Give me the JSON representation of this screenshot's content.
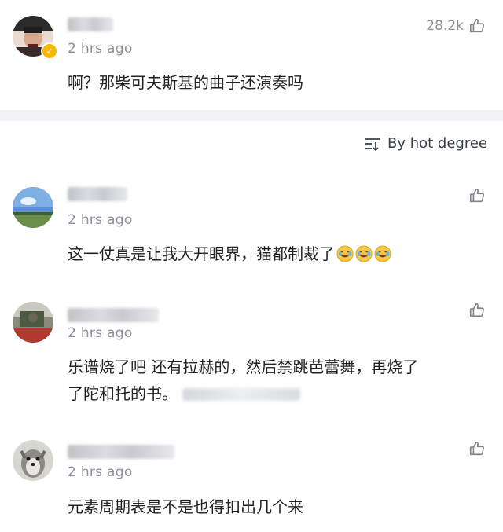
{
  "top_comment": {
    "time": "2 hrs ago",
    "likes": "28.2k",
    "text": "啊？那柴可夫斯基的曲子还演奏吗"
  },
  "sort": {
    "label": "By hot degree",
    "icon": "sort-icon"
  },
  "comments": [
    {
      "time": "2 hrs ago",
      "text": "这一仗真是让我大开眼界，猫都制裁了",
      "emoji": [
        "laugh-cry-emoji",
        "laugh-cry-emoji",
        "laugh-cry-emoji"
      ]
    },
    {
      "time": "2 hrs ago",
      "text_line1": "乐谱烧了吧 还有拉赫的，然后禁跳芭蕾舞，再烧了",
      "text_line2": "了陀和托的书。"
    },
    {
      "time": "2 hrs ago",
      "text": "元素周期表是不是也得扣出几个来"
    }
  ],
  "colors": {
    "divider": "#f2f3f5",
    "muted_text": "#8a8f99",
    "badge": "#f5b700"
  }
}
